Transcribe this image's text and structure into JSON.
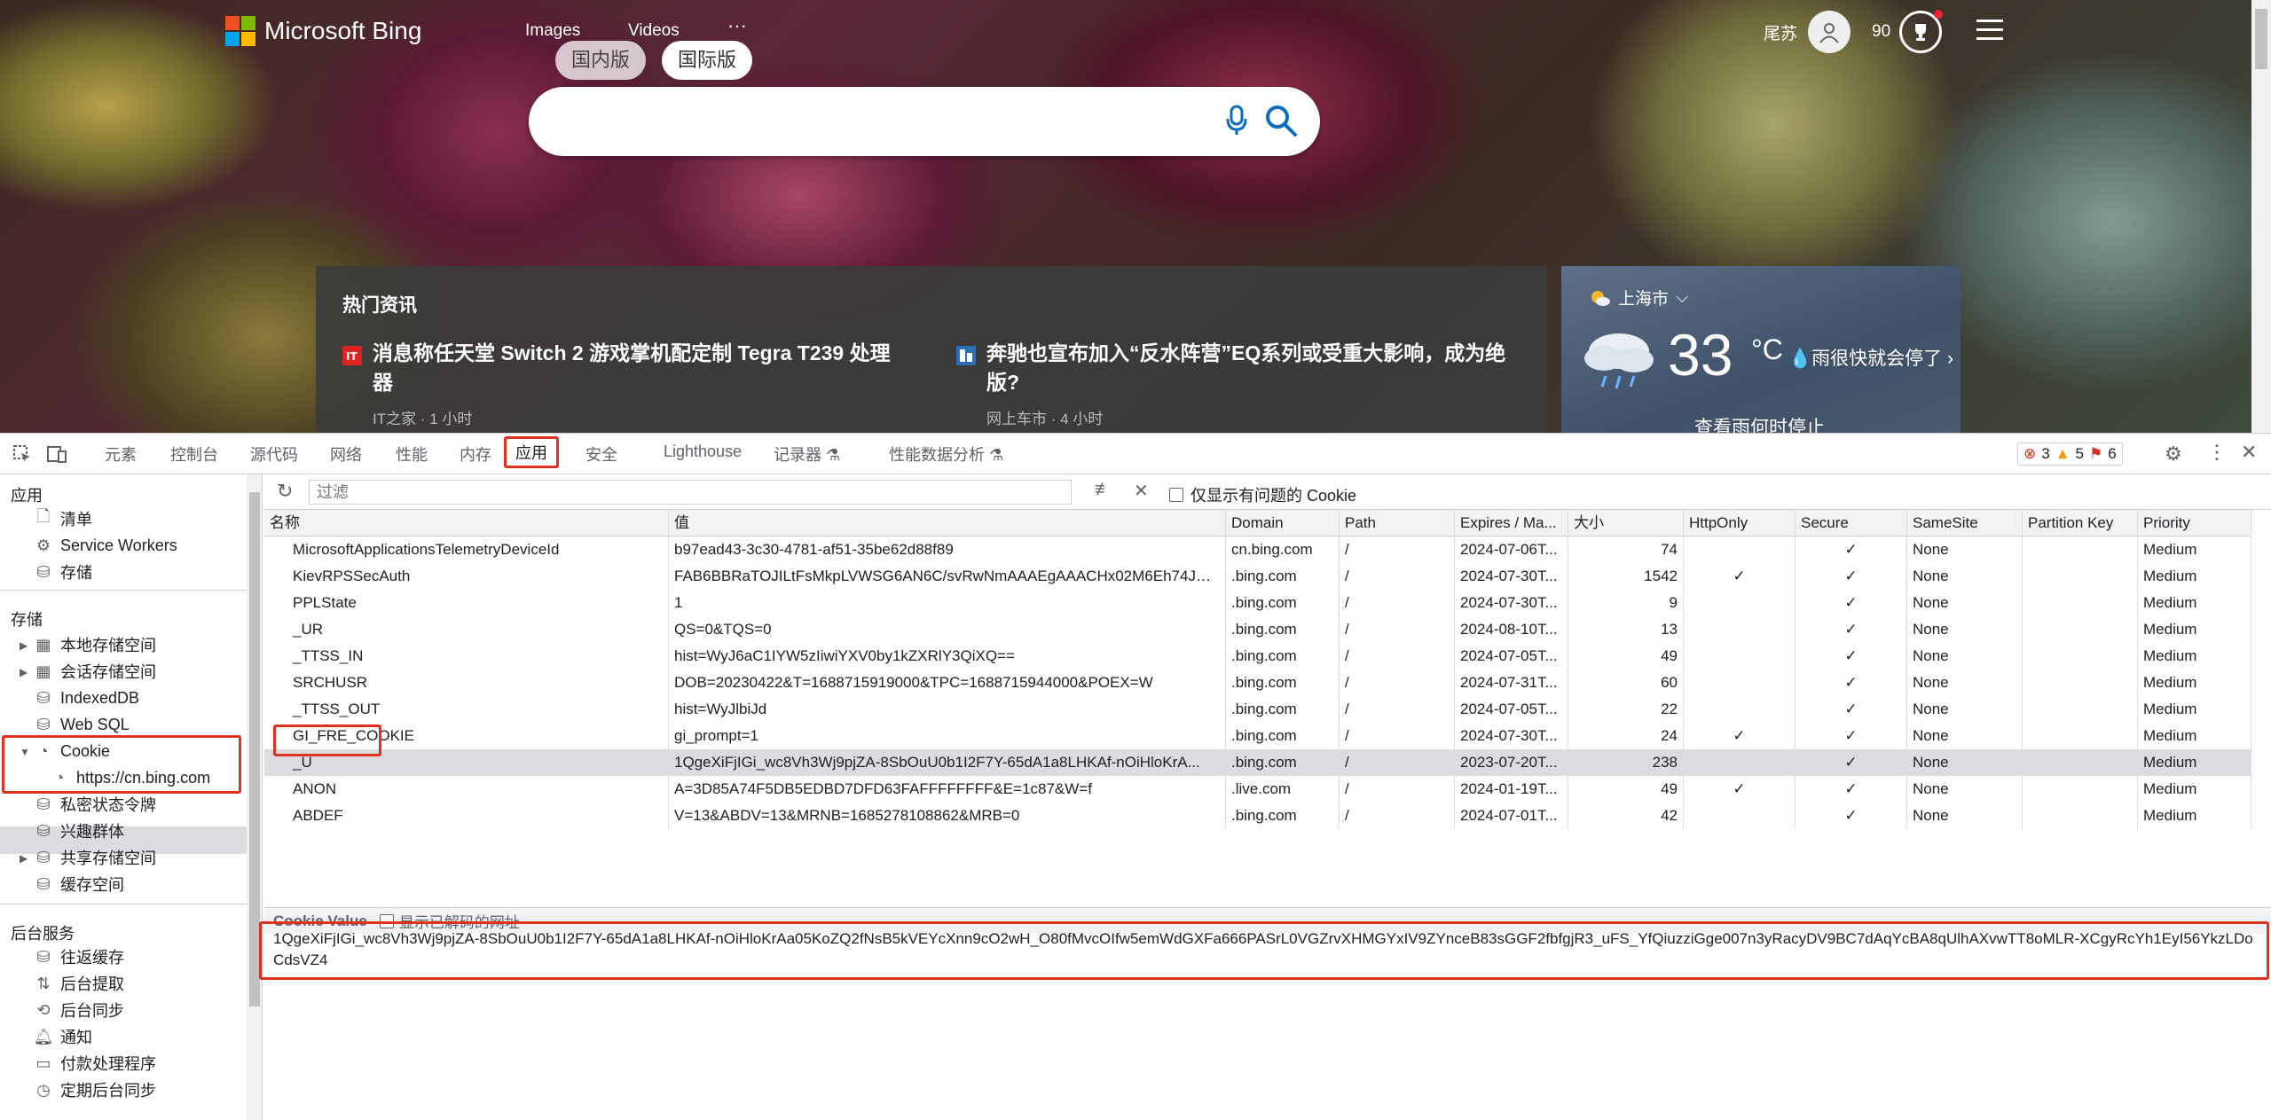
{
  "bing": {
    "brand": "Microsoft Bing",
    "nav": [
      "Images",
      "Videos",
      "···"
    ],
    "region_tabs": [
      "国内版",
      "国际版"
    ],
    "user_name": "尾苏",
    "rewards_points": "90",
    "news": {
      "heading": "热门资讯",
      "items": [
        {
          "title": "消息称任天堂 Switch 2 游戏掌机配定制 Tegra T239 处理器",
          "meta": "IT之家 · 1 小时"
        },
        {
          "title": "奔驰也宣布加入“反水阵营”EQ系列或受重大影响，成为绝版?",
          "meta": "网上车市 · 4 小时"
        }
      ]
    },
    "weather": {
      "city": "上海市",
      "temp": "33",
      "unit": "°C",
      "desc": "雨很快就会停了",
      "more": "查看雨何时停止"
    }
  },
  "devtools": {
    "tabs": [
      "元素",
      "控制台",
      "源代码",
      "网络",
      "性能",
      "内存",
      "应用",
      "安全",
      "Lighthouse",
      "记录器",
      "性能数据分析"
    ],
    "active_tab": "应用",
    "issues": {
      "errors": "3",
      "warnings": "5",
      "infos": "6"
    },
    "sidebar": {
      "sections": {
        "application": "应用",
        "storage": "存储",
        "background": "后台服务"
      },
      "app_items": [
        "清单",
        "Service Workers",
        "存储"
      ],
      "storage_items": [
        "本地存储空间",
        "会话存储空间",
        "IndexedDB",
        "Web SQL",
        "Cookie",
        "https://cn.bing.com",
        "私密状态令牌",
        "兴趣群体",
        "共享存储空间",
        "缓存空间"
      ],
      "background_items": [
        "往返缓存",
        "后台提取",
        "后台同步",
        "通知",
        "付款处理程序",
        "定期后台同步"
      ]
    },
    "filter": {
      "placeholder": "过滤",
      "only_issues_label": "仅显示有问题的 Cookie"
    },
    "columns": [
      "名称",
      "值",
      "Domain",
      "Path",
      "Expires / Ma...",
      "大小",
      "HttpOnly",
      "Secure",
      "SameSite",
      "Partition Key",
      "Priority"
    ],
    "rows": [
      {
        "name": "MicrosoftApplicationsTelemetryDeviceId",
        "value": "b97ead43-3c30-4781-af51-35be62d88f89",
        "domain": "cn.bing.com",
        "path": "/",
        "expires": "2024-07-06T...",
        "size": "74",
        "httponly": "",
        "secure": "✓",
        "samesite": "None",
        "partition": "",
        "priority": "Medium"
      },
      {
        "name": "KievRPSSecAuth",
        "value": "FAB6BBRaTOJILtFsMkpLVWSG6AN6C/svRwNmAAAEgAAACHx02M6Eh74JO...",
        "domain": ".bing.com",
        "path": "/",
        "expires": "2024-07-30T...",
        "size": "1542",
        "httponly": "✓",
        "secure": "✓",
        "samesite": "None",
        "partition": "",
        "priority": "Medium"
      },
      {
        "name": "PPLState",
        "value": "1",
        "domain": ".bing.com",
        "path": "/",
        "expires": "2024-07-30T...",
        "size": "9",
        "httponly": "",
        "secure": "✓",
        "samesite": "None",
        "partition": "",
        "priority": "Medium"
      },
      {
        "name": "_UR",
        "value": "QS=0&TQS=0",
        "domain": ".bing.com",
        "path": "/",
        "expires": "2024-08-10T...",
        "size": "13",
        "httponly": "",
        "secure": "✓",
        "samesite": "None",
        "partition": "",
        "priority": "Medium"
      },
      {
        "name": "_TTSS_IN",
        "value": "hist=WyJ6aC1IYW5zIiwiYXV0by1kZXRlY3QiXQ==",
        "domain": ".bing.com",
        "path": "/",
        "expires": "2024-07-05T...",
        "size": "49",
        "httponly": "",
        "secure": "✓",
        "samesite": "None",
        "partition": "",
        "priority": "Medium"
      },
      {
        "name": "SRCHUSR",
        "value": "DOB=20230422&T=1688715919000&TPC=1688715944000&POEX=W",
        "domain": ".bing.com",
        "path": "/",
        "expires": "2024-07-31T...",
        "size": "60",
        "httponly": "",
        "secure": "✓",
        "samesite": "None",
        "partition": "",
        "priority": "Medium"
      },
      {
        "name": "_TTSS_OUT",
        "value": "hist=WyJlbiJd",
        "domain": ".bing.com",
        "path": "/",
        "expires": "2024-07-05T...",
        "size": "22",
        "httponly": "",
        "secure": "✓",
        "samesite": "None",
        "partition": "",
        "priority": "Medium"
      },
      {
        "name": "GI_FRE_COOKIE",
        "value": "gi_prompt=1",
        "domain": ".bing.com",
        "path": "/",
        "expires": "2024-07-30T...",
        "size": "24",
        "httponly": "✓",
        "secure": "✓",
        "samesite": "None",
        "partition": "",
        "priority": "Medium"
      },
      {
        "name": "_U",
        "value": "1QgeXiFjIGi_wc8Vh3Wj9pjZA-8SbOuU0b1I2F7Y-65dA1a8LHKAf-nOiHloKrA...",
        "domain": ".bing.com",
        "path": "/",
        "expires": "2023-07-20T...",
        "size": "238",
        "httponly": "",
        "secure": "✓",
        "samesite": "None",
        "partition": "",
        "priority": "Medium"
      },
      {
        "name": "ANON",
        "value": "A=3D85A74F5DB5EDBD7DFD63FAFFFFFFFF&E=1c87&W=f",
        "domain": ".live.com",
        "path": "/",
        "expires": "2024-01-19T...",
        "size": "49",
        "httponly": "✓",
        "secure": "✓",
        "samesite": "None",
        "partition": "",
        "priority": "Medium"
      },
      {
        "name": "ABDEF",
        "value": "V=13&ABDV=13&MRNB=1685278108862&MRB=0",
        "domain": ".bing.com",
        "path": "/",
        "expires": "2024-07-01T...",
        "size": "42",
        "httponly": "",
        "secure": "✓",
        "samesite": "None",
        "partition": "",
        "priority": "Medium"
      }
    ],
    "selected_row": "_U",
    "cookie_value": {
      "title": "Cookie Value",
      "decode_label": "显示已解码的网址",
      "value": "1QgeXiFjIGi_wc8Vh3Wj9pjZA-8SbOuU0b1I2F7Y-65dA1a8LHKAf-nOiHloKrAa05KoZQ2fNsB5kVEYcXnn9cO2wH_O80fMvcOIfw5emWdGXFa666PASrL0VGZrvXHMGYxIV9ZYnceB83sGGF2fbfgjR3_uFS_YfQiuzziGge007n3yRacyDV9BC7dAqYcBA8qUlhAXvwTT8oMLR-XCgyRcYh1EyI56YkzLDoCdsVZ4"
    }
  }
}
